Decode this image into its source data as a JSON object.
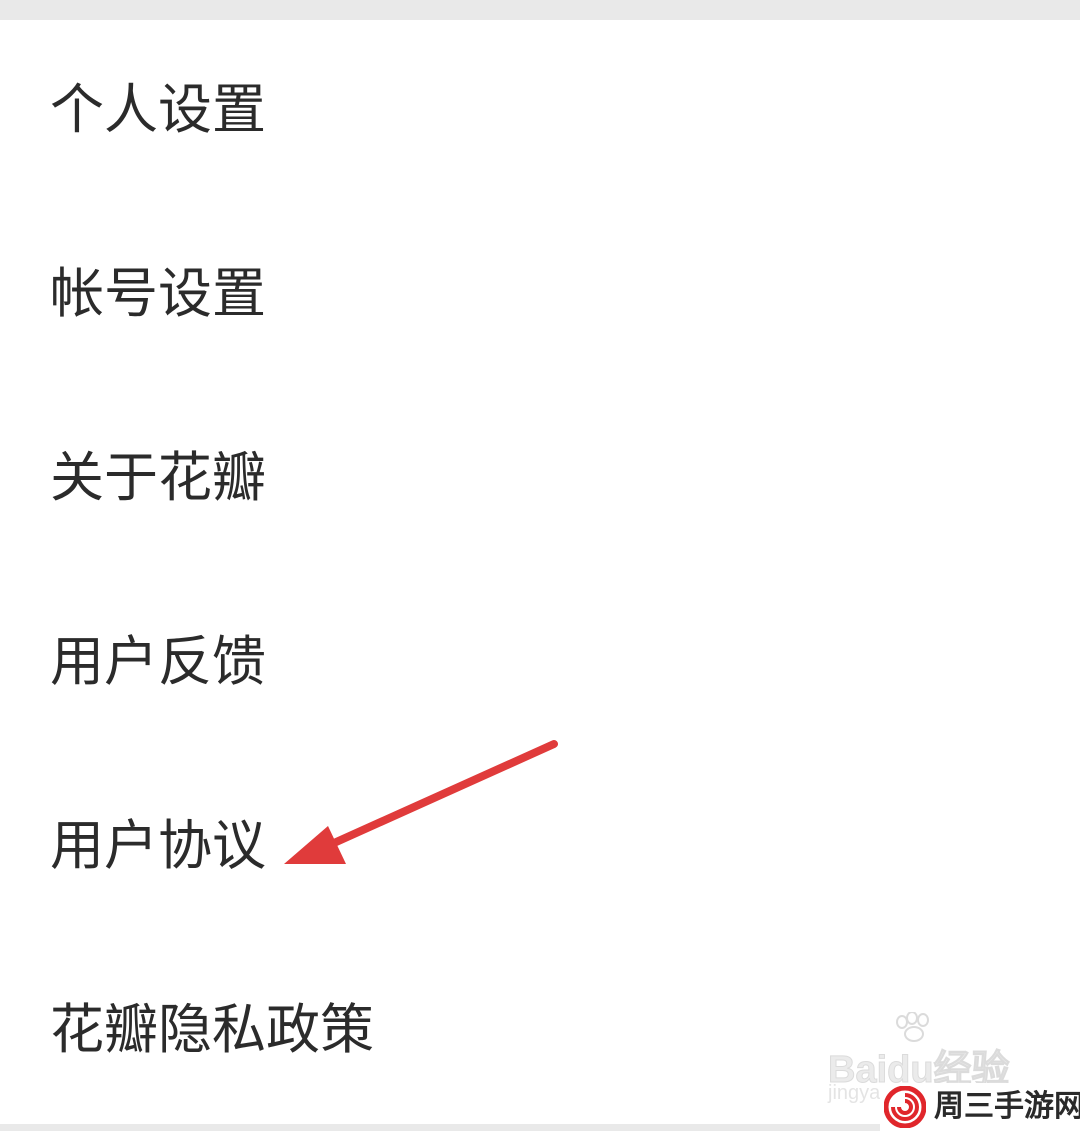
{
  "menu": {
    "items": [
      {
        "label": "个人设置"
      },
      {
        "label": "帐号设置"
      },
      {
        "label": "关于花瓣"
      },
      {
        "label": "用户反馈"
      },
      {
        "label": "用户协议"
      },
      {
        "label": "花瓣隐私政策"
      }
    ]
  },
  "annotation": {
    "arrow_color": "#e03b3b",
    "points_to": "用户协议"
  },
  "watermark": {
    "brand": "Baidu经验",
    "sub": "jingyan"
  },
  "badge": {
    "text": "周三手游网",
    "logo_color": "#e0262b",
    "logo_icon": "spiral-logo-icon"
  }
}
